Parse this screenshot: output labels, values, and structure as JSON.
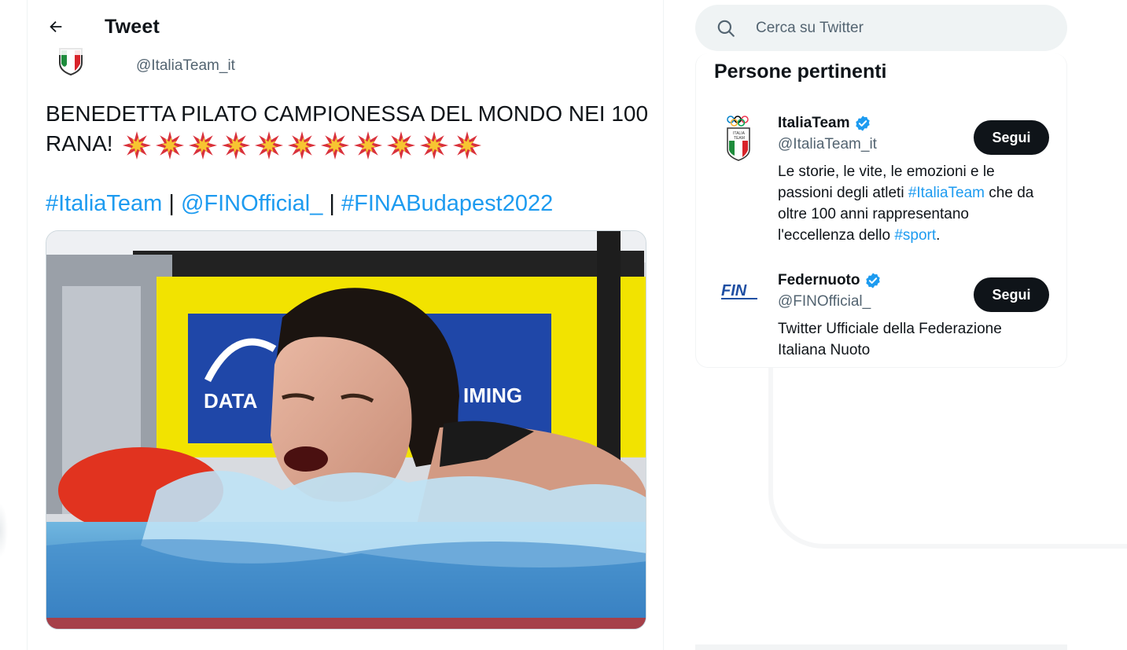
{
  "header": {
    "title": "Tweet"
  },
  "tweet": {
    "author_handle": "@ItaliaTeam_it",
    "text": "BENEDETTA PILATO CAMPIONESSA DEL MONDO NEI 100 RANA!",
    "star_count": 11,
    "links": {
      "hashtag_1": "#ItaliaTeam",
      "separator_1": " | ",
      "mention": "@FINOfficial_",
      "separator_2": " | ",
      "hashtag_2": "#FINABudapest2022"
    },
    "media_icon": "swimmer-photo"
  },
  "search": {
    "placeholder": "Cerca su Twitter"
  },
  "related": {
    "title": "Persone pertinenti",
    "people": [
      {
        "name": "ItaliaTeam",
        "handle": "@ItaliaTeam_it",
        "bio_parts": [
          "Le storie, le vite, le emozioni e le passioni degli atleti ",
          "#ItaliaTeam",
          " che da oltre 100 anni rappresentano l'eccellenza dello ",
          "#sport",
          "."
        ],
        "follow_label": "Segui",
        "avatar_icon": "italia-team-logo"
      },
      {
        "name": "Federnuoto",
        "handle": "@FINOfficial_",
        "bio": "Twitter Ufficiale della Federazione Italiana Nuoto",
        "follow_label": "Segui",
        "avatar_icon": "fin-logo",
        "logo_text": "FIN"
      }
    ]
  },
  "colors": {
    "link": "#1d9bf0",
    "text": "#0f1419",
    "muted": "#536471",
    "button_bg": "#0f1419",
    "verified": "#1d9bf0"
  }
}
